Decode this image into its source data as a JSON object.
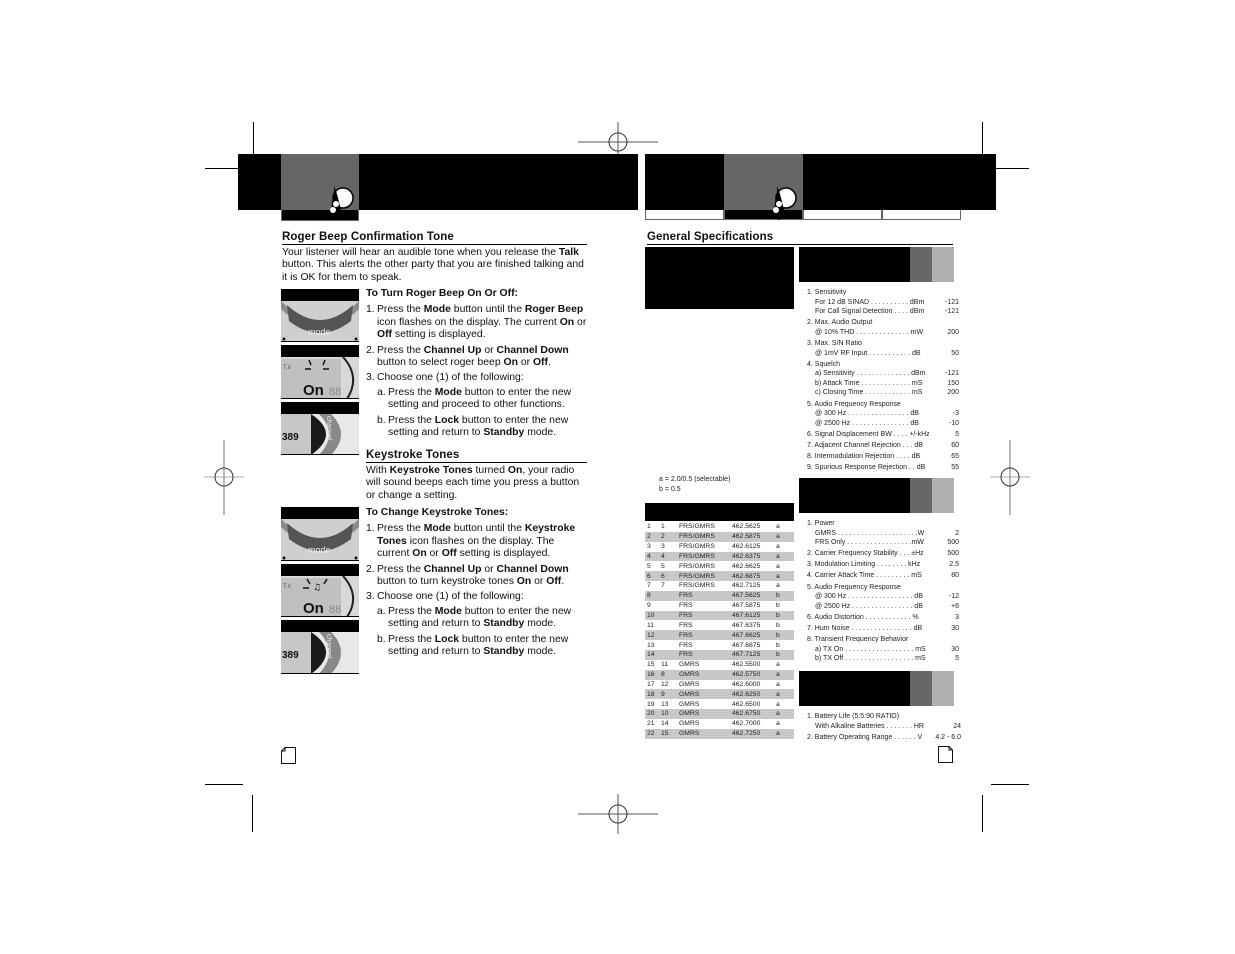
{
  "left_page": {
    "section1": {
      "heading": "Roger Beep Confirmation Tone",
      "intro": [
        {
          "t": "Your listener will hear an audible tone when you release the ",
          "b": false
        },
        {
          "t": "Talk",
          "b": true
        },
        {
          "t": " button. This alerts the other party that you are finished talking and it is OK for them to speak.",
          "b": false
        }
      ],
      "subheading": "To Turn Roger Beep On Or Off:",
      "steps": [
        {
          "n": "1.",
          "parts": [
            {
              "t": "Press the ",
              "b": false
            },
            {
              "t": "Mode",
              "b": true
            },
            {
              "t": " button until the ",
              "b": false
            },
            {
              "t": "Roger Beep",
              "b": true
            },
            {
              "t": " icon flashes on the display. The current ",
              "b": false
            },
            {
              "t": "On",
              "b": true
            },
            {
              "t": " or ",
              "b": false
            },
            {
              "t": "Off",
              "b": true
            },
            {
              "t": " setting is displayed.",
              "b": false
            }
          ]
        },
        {
          "n": "2.",
          "parts": [
            {
              "t": "Press the ",
              "b": false
            },
            {
              "t": "Channel Up",
              "b": true
            },
            {
              "t": " or ",
              "b": false
            },
            {
              "t": "Channel Down",
              "b": true
            },
            {
              "t": " button to select roger beep ",
              "b": false
            },
            {
              "t": "On",
              "b": true
            },
            {
              "t": " or ",
              "b": false
            },
            {
              "t": "Off",
              "b": true
            },
            {
              "t": ".",
              "b": false
            }
          ]
        },
        {
          "n": "3.",
          "parts": [
            {
              "t": "Choose one (1) of the following:",
              "b": false
            }
          ]
        }
      ],
      "substeps": [
        {
          "n": "a.",
          "parts": [
            {
              "t": "Press the ",
              "b": false
            },
            {
              "t": "Mode",
              "b": true
            },
            {
              "t": " button to enter the new setting and proceed to other functions.",
              "b": false
            }
          ]
        },
        {
          "n": "b.",
          "parts": [
            {
              "t": "Press the ",
              "b": false
            },
            {
              "t": "Lock",
              "b": true
            },
            {
              "t": " button to enter the new setting and return to ",
              "b": false
            },
            {
              "t": "Standby",
              "b": true
            },
            {
              "t": " mode.",
              "b": false
            }
          ]
        }
      ],
      "thumbnails": [
        "mode-button-photo",
        "roger-beep-display-photo",
        "channel-button-photo"
      ],
      "thumb_labels": {
        "mode": "mode",
        "channel": "channel",
        "display_on": "On",
        "display_digits": "88",
        "display_channel": "389"
      }
    },
    "section2": {
      "heading": "Keystroke Tones",
      "intro": [
        {
          "t": "With ",
          "b": false
        },
        {
          "t": "Keystroke Tones",
          "b": true
        },
        {
          "t": " turned ",
          "b": false
        },
        {
          "t": "On",
          "b": true
        },
        {
          "t": ", your radio will sound beeps each time you press a button or change a setting.",
          "b": false
        }
      ],
      "subheading": "To Change Keystroke Tones:",
      "steps": [
        {
          "n": "1.",
          "parts": [
            {
              "t": "Press the ",
              "b": false
            },
            {
              "t": "Mode",
              "b": true
            },
            {
              "t": " button until the ",
              "b": false
            },
            {
              "t": "Keystroke Tones",
              "b": true
            },
            {
              "t": " icon flashes on the display. The current ",
              "b": false
            },
            {
              "t": "On",
              "b": true
            },
            {
              "t": " or ",
              "b": false
            },
            {
              "t": "Off",
              "b": true
            },
            {
              "t": " setting is displayed.",
              "b": false
            }
          ]
        },
        {
          "n": "2.",
          "parts": [
            {
              "t": "Press the ",
              "b": false
            },
            {
              "t": "Channel Up",
              "b": true
            },
            {
              "t": " or ",
              "b": false
            },
            {
              "t": "Channel Down",
              "b": true
            },
            {
              "t": " button to turn keystroke tones ",
              "b": false
            },
            {
              "t": "On",
              "b": true
            },
            {
              "t": " or ",
              "b": false
            },
            {
              "t": "Off",
              "b": true
            },
            {
              "t": ".",
              "b": false
            }
          ]
        },
        {
          "n": "3.",
          "parts": [
            {
              "t": "Choose one (1) of the following:",
              "b": false
            }
          ]
        }
      ],
      "substeps": [
        {
          "n": "a.",
          "parts": [
            {
              "t": "Press the ",
              "b": false
            },
            {
              "t": "Mode",
              "b": true
            },
            {
              "t": " button to enter the new setting and return to ",
              "b": false
            },
            {
              "t": "Standby",
              "b": true
            },
            {
              "t": " mode.",
              "b": false
            }
          ]
        },
        {
          "n": "b.",
          "parts": [
            {
              "t": "Press the ",
              "b": false
            },
            {
              "t": "Lock",
              "b": true
            },
            {
              "t": " button to enter the new setting and return to ",
              "b": false
            },
            {
              "t": "Standby",
              "b": true
            },
            {
              "t": " mode.",
              "b": false
            }
          ]
        }
      ],
      "thumbnails": [
        "mode-button-photo",
        "keystroke-display-photo",
        "channel-button-photo"
      ]
    }
  },
  "right_page": {
    "heading": "General Specifications",
    "bandwidth_notes": [
      "a = 2.0/0.5 (selectable)",
      "b = 0.5"
    ],
    "channels": [
      [
        "1",
        "1",
        "FRS/GMRS",
        "462.5625",
        "a"
      ],
      [
        "2",
        "2",
        "FRS/GMRS",
        "462.5875",
        "a"
      ],
      [
        "3",
        "3",
        "FRS/GMRS",
        "462.6125",
        "a"
      ],
      [
        "4",
        "4",
        "FRS/GMRS",
        "462.6375",
        "a"
      ],
      [
        "5",
        "5",
        "FRS/GMRS",
        "462.6625",
        "a"
      ],
      [
        "6",
        "6",
        "FRS/GMRS",
        "462.6875",
        "a"
      ],
      [
        "7",
        "7",
        "FRS/GMRS",
        "462.7125",
        "a"
      ],
      [
        "8",
        "",
        "FRS",
        "467.5625",
        "b"
      ],
      [
        "9",
        "",
        "FRS",
        "467.5875",
        "b"
      ],
      [
        "10",
        "",
        "FRS",
        "467.6125",
        "b"
      ],
      [
        "11",
        "",
        "FRS",
        "467.6375",
        "b"
      ],
      [
        "12",
        "",
        "FRS",
        "467.6625",
        "b"
      ],
      [
        "13",
        "",
        "FRS",
        "467.6875",
        "b"
      ],
      [
        "14",
        "",
        "FRS",
        "467.7125",
        "b"
      ],
      [
        "15",
        "11",
        "GMRS",
        "462.5500",
        "a"
      ],
      [
        "16",
        "8",
        "GMRS",
        "462.5750",
        "a"
      ],
      [
        "17",
        "12",
        "GMRS",
        "462.6000",
        "a"
      ],
      [
        "18",
        "9",
        "GMRS",
        "462.6250",
        "a"
      ],
      [
        "19",
        "13",
        "GMRS",
        "462.6500",
        "a"
      ],
      [
        "20",
        "10",
        "GMRS",
        "462.6750",
        "a"
      ],
      [
        "21",
        "14",
        "GMRS",
        "462.7000",
        "a"
      ],
      [
        "22",
        "15",
        "GMRS",
        "462.7250",
        "a"
      ]
    ],
    "receiver_specs": [
      {
        "title": "1. Sensitivity",
        "rows": [
          [
            "For 12 dB SINAD . . . . . . . . . . dBm",
            "-121"
          ],
          [
            "For Call Signal Detection . . . . dBm",
            "-121"
          ]
        ]
      },
      {
        "title": "2. Max. Audio Output",
        "rows": [
          [
            "@ 10% THD . . . . . . . . . . . . . . mW",
            "200"
          ]
        ]
      },
      {
        "title": "3. Max. S/N Ratio",
        "rows": [
          [
            "@ 1mV RF Input . . . . . . . . . . . dB",
            "50"
          ]
        ]
      },
      {
        "title": "4. Squelch",
        "rows": [
          [
            "a) Sensitivity . . . . . . . . . . . . . . dBm",
            "-121"
          ],
          [
            "b) Attack Time . . . . . . . . . . . . . mS",
            "150"
          ],
          [
            "c) Closing Time . . . . . . . . . . . . mS",
            "200"
          ]
        ]
      },
      {
        "title": "5. Audio Frequency Response",
        "rows": [
          [
            "@ 300 Hz . . . . . . . . . . . . . . . . dB",
            "-3"
          ],
          [
            "@ 2500 Hz . . . . . . . . . . . . . . . dB",
            "-10"
          ]
        ]
      },
      {
        "title": "",
        "rows": [
          [
            "6. Signal Displacement BW . . . . +/-kHz",
            "5"
          ]
        ],
        "top": true
      },
      {
        "title": "",
        "rows": [
          [
            "7. Adjacent Channel Rejection . . . dB",
            "60"
          ]
        ],
        "top": true
      },
      {
        "title": "",
        "rows": [
          [
            "8. Intermodulation Rejection . . . . dB",
            "65"
          ]
        ],
        "top": true
      },
      {
        "title": "",
        "rows": [
          [
            "9. Spurious Response Rejection . . dB",
            "55"
          ]
        ],
        "top": true
      }
    ],
    "transmitter_specs": [
      {
        "title": "1. Power",
        "rows": [
          [
            "GMRS . . . . . . . . . . . . . . . . . . . . .W",
            "2"
          ],
          [
            "FRS Only . . . . . . . . . . . . . . . . .mW",
            "500"
          ]
        ]
      },
      {
        "title": "",
        "rows": [
          [
            "2. Carrier Frequency Stability . . . ±Hz",
            "500"
          ]
        ],
        "top": true
      },
      {
        "title": "",
        "rows": [
          [
            "3. Modulation Limiting . . . . . . . . kHz",
            "2.5"
          ]
        ],
        "top": true
      },
      {
        "title": "",
        "rows": [
          [
            "4. Carrier Attack Time . . . . . . . . . mS",
            "80"
          ]
        ],
        "top": true
      },
      {
        "title": "5. Audio Frequency Response",
        "rows": [
          [
            "@ 300 Hz . . . . . . . . . . . . . . . . . dB",
            "-12"
          ],
          [
            "@ 2500 Hz . . . . . . . . . . . . . . . . dB",
            "+6"
          ]
        ]
      },
      {
        "title": "",
        "rows": [
          [
            "6. Audio Distortion . . . . . . . . . . . . %",
            "3"
          ]
        ],
        "top": true
      },
      {
        "title": "",
        "rows": [
          [
            "7. Hum Noise . . . . . . . . . . . . . . . . dB",
            "30"
          ]
        ],
        "top": true
      },
      {
        "title": "8. Transient Frequency Behavior",
        "rows": [
          [
            "a) TX On . . . . . . . . . . . . . . . . . . mS",
            "30"
          ],
          [
            "b) TX Off . . . . . . . . . . . . . . . . . . mS",
            "5"
          ]
        ]
      }
    ],
    "battery_specs": [
      {
        "title": "1. Battery Life (5:5:90 RATIO)",
        "rows": [
          [
            "With Alkaline Batteries . . . . . . . HR",
            "24"
          ]
        ]
      },
      {
        "title": "",
        "rows": [
          [
            "2. Battery Operating Range . . . . . . V",
            "4.2 - 6.0"
          ]
        ],
        "top": true
      }
    ]
  },
  "icons": {
    "header_logo": "walkie-talkie-icon",
    "page_number_left": "page-icon",
    "page_number_right": "page-icon"
  }
}
